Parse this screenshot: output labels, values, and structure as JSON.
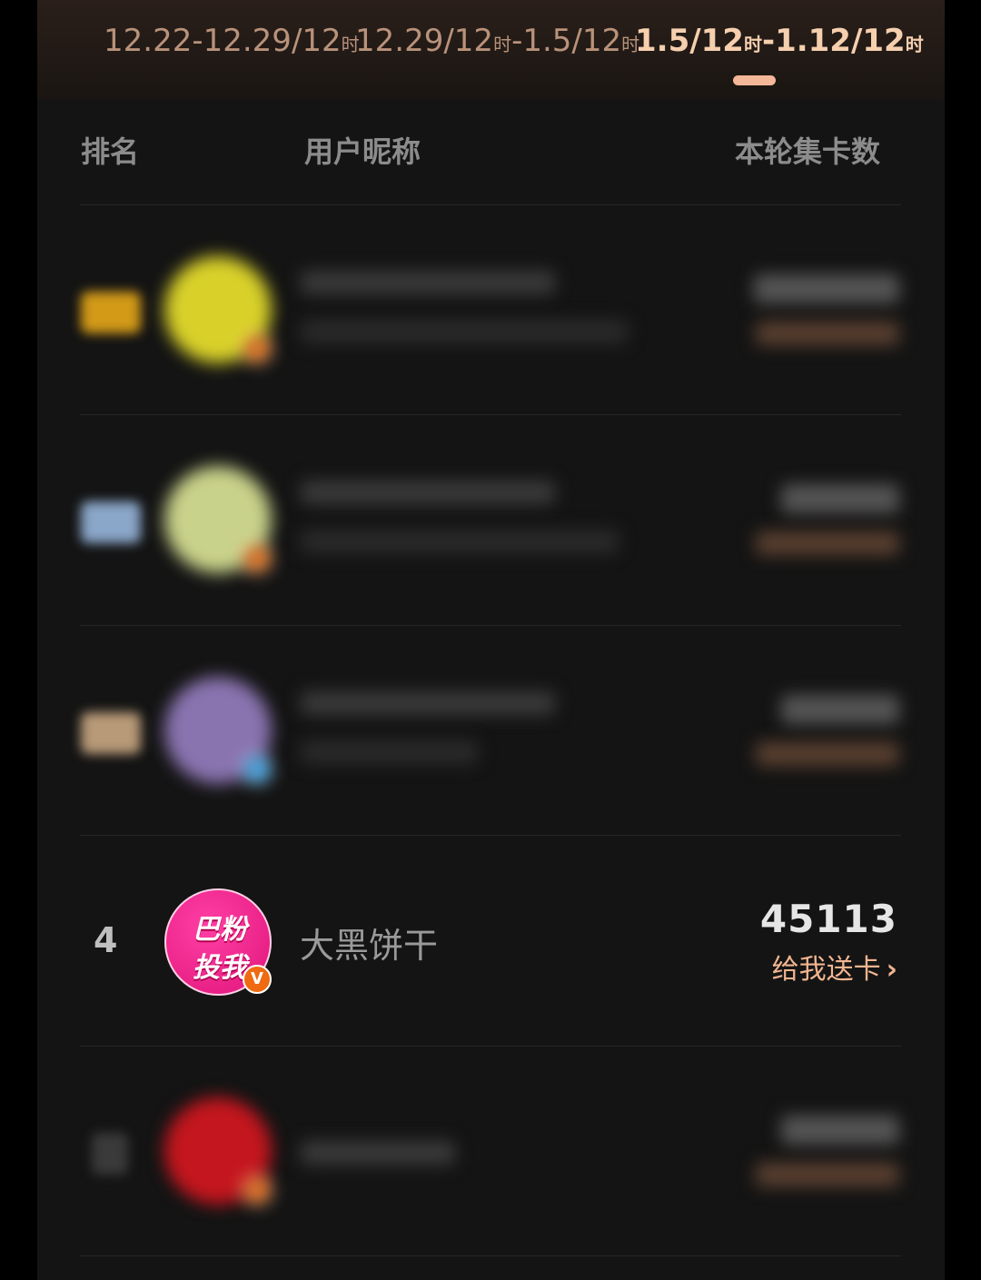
{
  "tabs": [
    {
      "start": "12.22-12.29/12",
      "unit": "时",
      "label_a": "12.22-12.29/12",
      "unit_a": "时",
      "active": false
    },
    {
      "label_a": "12.29/12",
      "unit_a": "时",
      "label_b": "-1.5/12",
      "unit_b": "时",
      "active": false
    },
    {
      "label_a": "1.5/12",
      "unit_a": "时",
      "label_b": "-1.12/12",
      "unit_b": "时",
      "active": true
    }
  ],
  "table": {
    "headers": {
      "rank": "排名",
      "nickname": "用户昵称",
      "cards": "本轮集卡数"
    }
  },
  "rows": [
    {
      "rank": "4",
      "nickname": "大黑饼干",
      "score": "45113",
      "give_label": "给我送卡",
      "avatar_text": [
        "巴粉",
        "投我"
      ],
      "badge": "V"
    }
  ],
  "colors": {
    "accent": "#f4b898",
    "background": "#141414",
    "tab_bg": "#2a1f1a"
  }
}
